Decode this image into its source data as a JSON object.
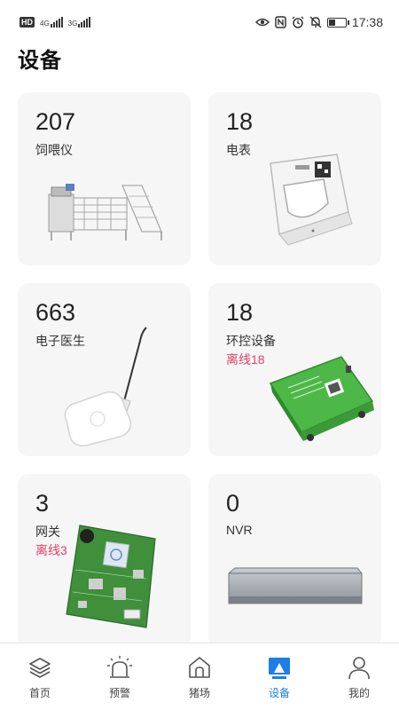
{
  "status_bar": {
    "left": {
      "hd": "HD",
      "net1": "4G",
      "net2": "3G"
    },
    "right": {
      "time": "17:38",
      "icons": [
        "eye-icon",
        "nfc-icon",
        "alarm-icon",
        "mute-icon",
        "battery-icon"
      ],
      "battery_level": 0.4
    }
  },
  "page": {
    "title": "设备"
  },
  "devices": [
    {
      "count": "207",
      "name": "饲喂仪",
      "offline": "",
      "image": "feeder-machine"
    },
    {
      "count": "18",
      "name": "电表",
      "offline": "",
      "image": "electric-meter"
    },
    {
      "count": "663",
      "name": "电子医生",
      "offline": "",
      "image": "electronic-doctor"
    },
    {
      "count": "18",
      "name": "环控设备",
      "offline": "离线18",
      "image": "environment-controller"
    },
    {
      "count": "3",
      "name": "网关",
      "offline": "离线3",
      "image": "gateway-board"
    },
    {
      "count": "0",
      "name": "NVR",
      "offline": "",
      "image": "nvr-box"
    }
  ],
  "nav": {
    "items": [
      {
        "label": "首页",
        "icon": "layers-icon",
        "active": false
      },
      {
        "label": "预警",
        "icon": "alarm-light-icon",
        "active": false
      },
      {
        "label": "猪场",
        "icon": "home-icon",
        "active": false
      },
      {
        "label": "设备",
        "icon": "device-icon",
        "active": true
      },
      {
        "label": "我的",
        "icon": "user-icon",
        "active": false
      }
    ]
  },
  "colors": {
    "accent": "#1d7ee8",
    "offline": "#e0406a",
    "card_bg": "#f6f6f6"
  }
}
